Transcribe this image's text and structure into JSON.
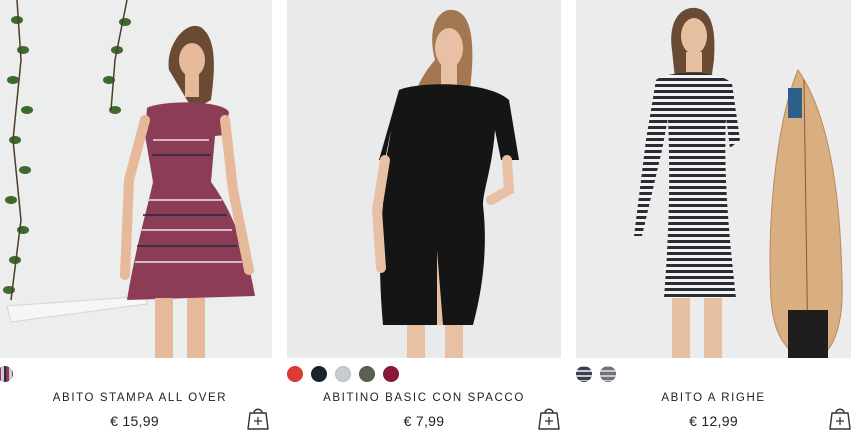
{
  "products": [
    {
      "name": "ABITO STAMPA ALL OVER",
      "price": "€ 15,99",
      "image_icon": "woman-in-patterned-dress-photo",
      "swatches": [
        {
          "icon": "pattern-swatch",
          "color": "#7a6a88"
        }
      ]
    },
    {
      "name": "ABITINO BASIC CON SPACCO",
      "price": "€ 7,99",
      "image_icon": "woman-in-black-dress-photo",
      "swatches": [
        {
          "icon": "red-swatch",
          "color": "#e03a36"
        },
        {
          "icon": "navy-swatch",
          "color": "#1c2230"
        },
        {
          "icon": "light-grey-swatch",
          "color": "#c9cccf"
        },
        {
          "icon": "olive-swatch",
          "color": "#5d5f55"
        },
        {
          "icon": "burgundy-swatch",
          "color": "#8a1838"
        }
      ]
    },
    {
      "name": "ABITO A RIGHE",
      "price": "€ 12,99",
      "image_icon": "woman-in-striped-dress-photo",
      "swatches": [
        {
          "icon": "navy-stripe-swatch",
          "color": "#3a4250"
        },
        {
          "icon": "grey-stripe-swatch",
          "color": "#6e7378"
        }
      ]
    }
  ],
  "cart_icon": "shopping-bag-add-icon"
}
